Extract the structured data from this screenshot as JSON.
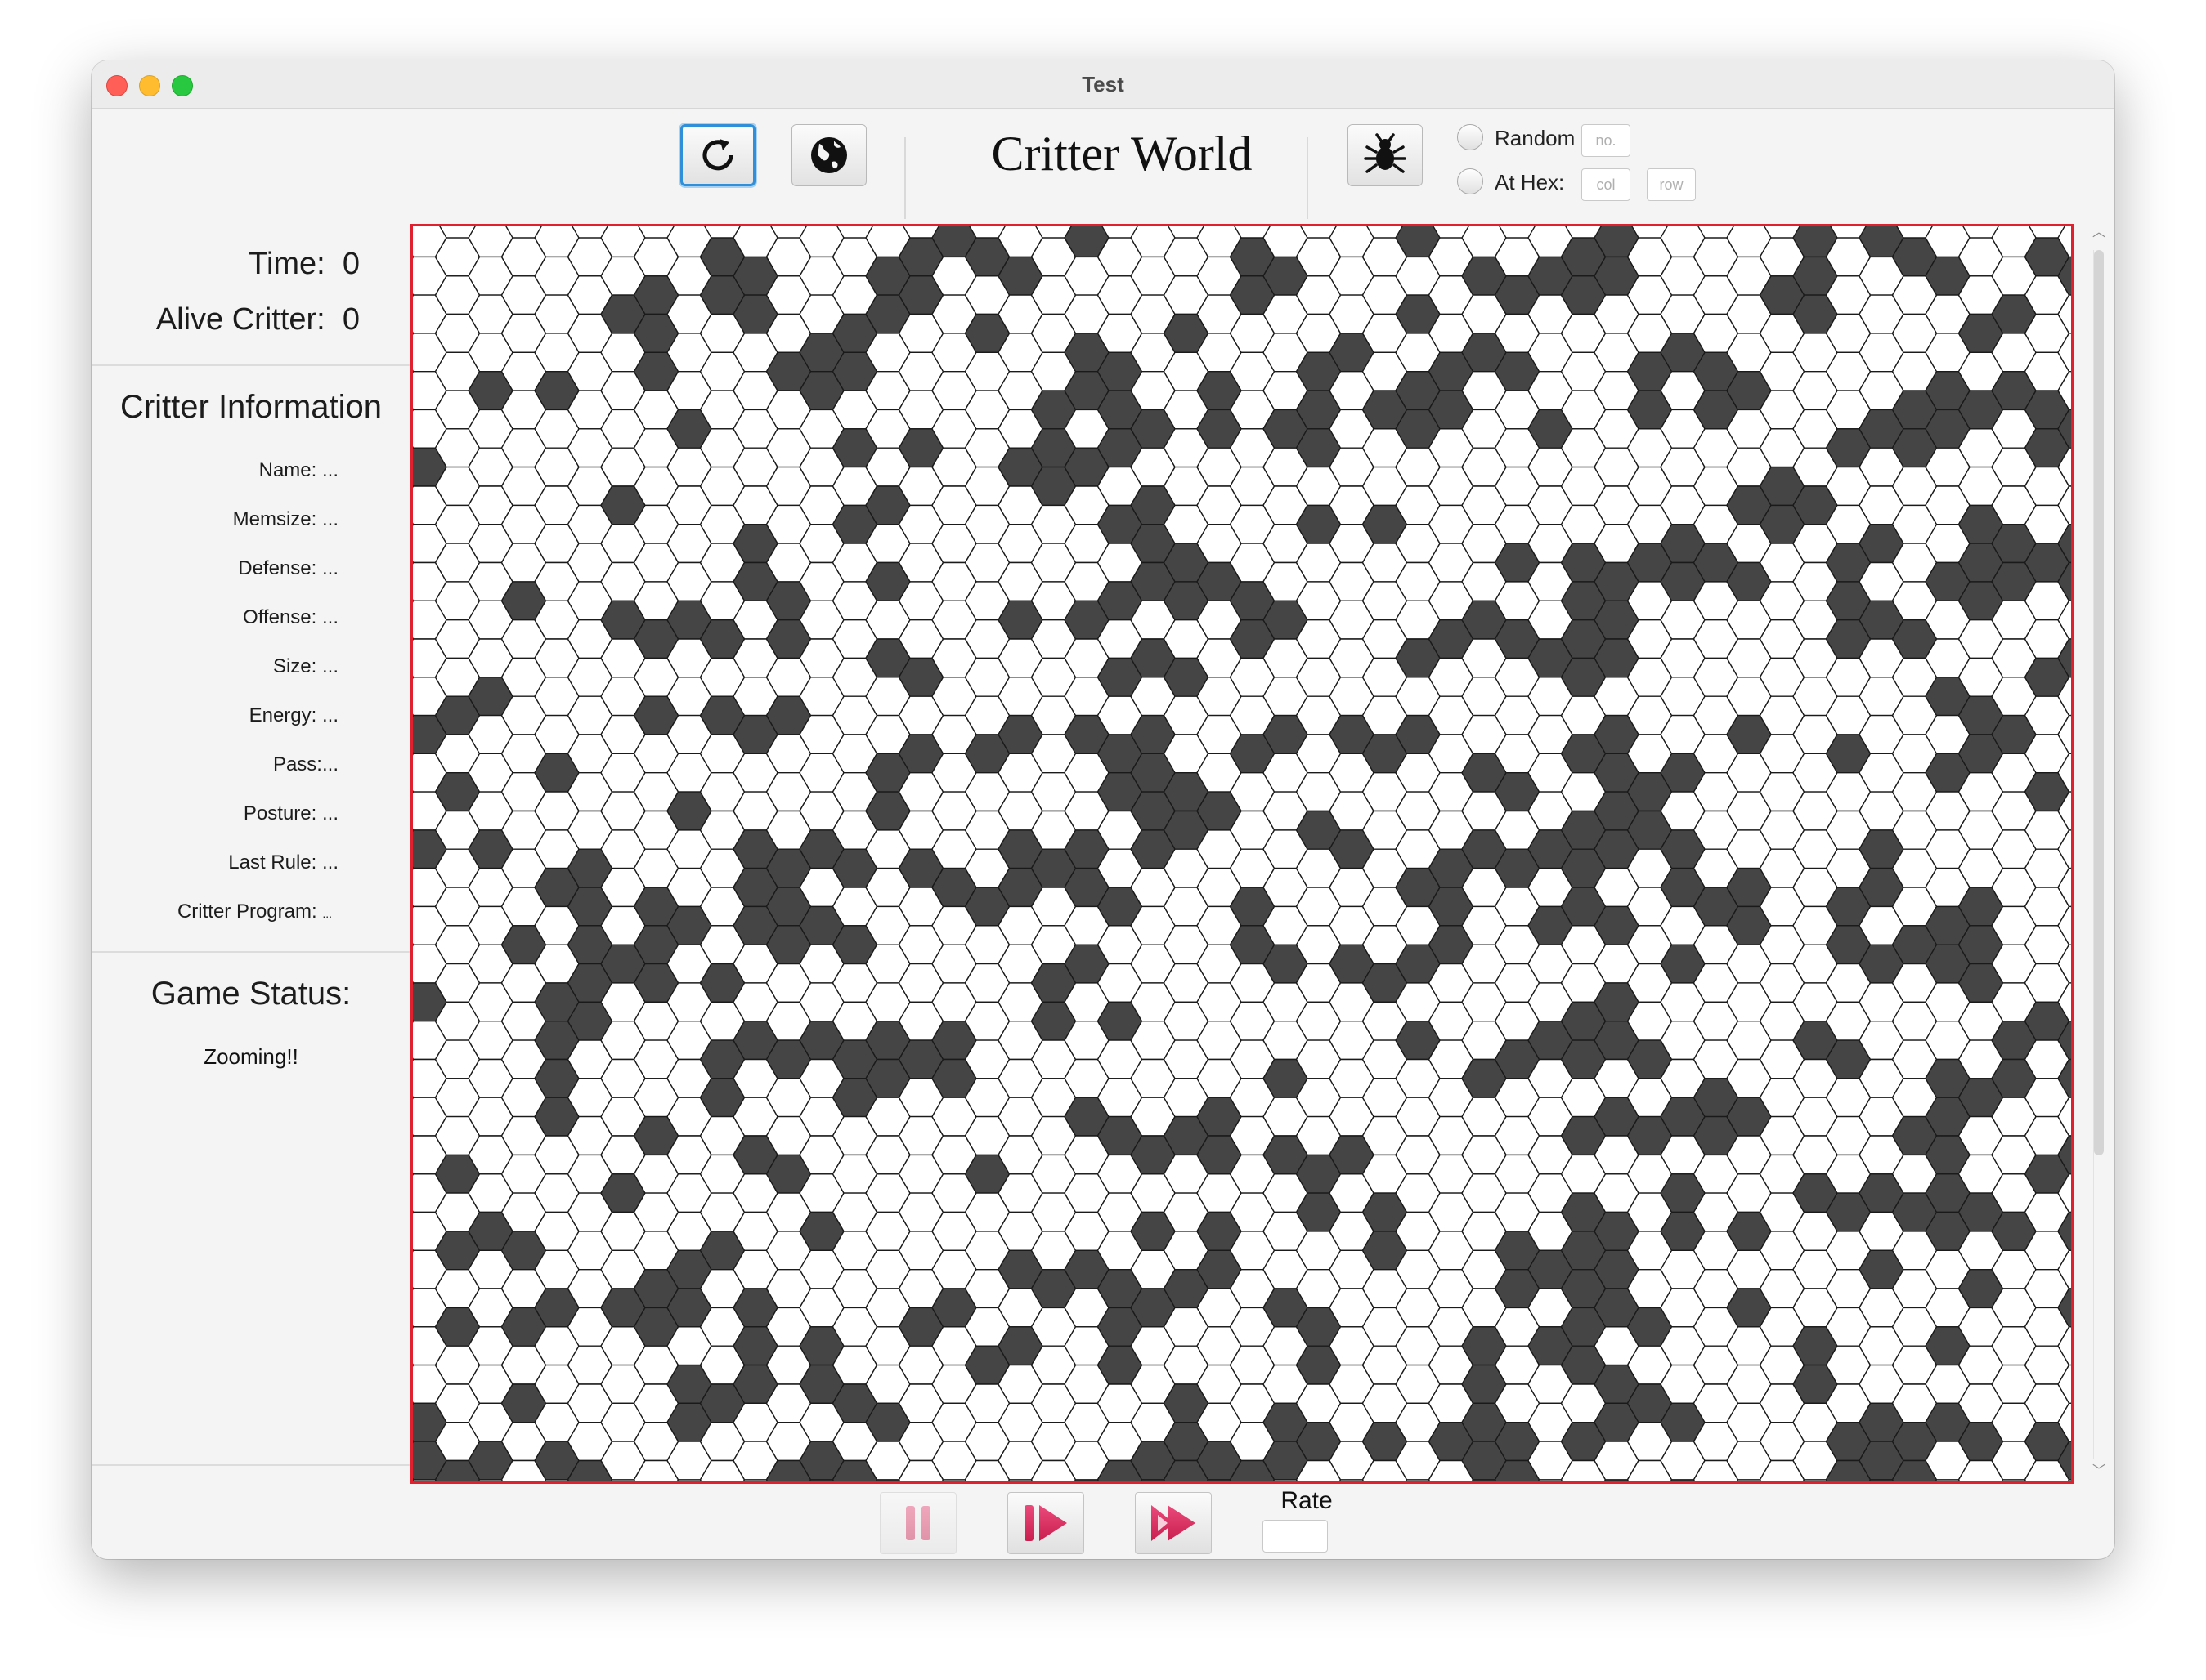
{
  "window": {
    "title": "Test"
  },
  "toolbar": {
    "app_title": "Critter World",
    "reset_icon": "refresh-icon",
    "world_icon": "globe-icon",
    "critter_icon": "critter-bug-icon",
    "placement": {
      "random_label": "Random",
      "at_hex_label": "At Hex:",
      "count_placeholder": "no.",
      "col_placeholder": "col",
      "row_placeholder": "row"
    }
  },
  "stats": {
    "time_label": "Time:",
    "time_value": "0",
    "alive_label": "Alive Critter:",
    "alive_value": "0"
  },
  "critter_info": {
    "heading": "Critter Information",
    "fields": [
      {
        "label": "Name:",
        "value": "..."
      },
      {
        "label": "Memsize:",
        "value": "..."
      },
      {
        "label": "Defense:",
        "value": "..."
      },
      {
        "label": "Offense:",
        "value": "..."
      },
      {
        "label": "Size:",
        "value": "..."
      },
      {
        "label": "Energy:",
        "value": "..."
      },
      {
        "label": "Pass:",
        "value": "..."
      },
      {
        "label": "Posture:",
        "value": "..."
      },
      {
        "label": "Last Rule:",
        "value": "..."
      },
      {
        "label": "Critter Program:",
        "value": "..."
      }
    ]
  },
  "game_status": {
    "heading": "Game Status:",
    "message": "Zooming!!"
  },
  "board": {
    "cell_colors": {
      "empty": "#ffffff",
      "rock": "#454545",
      "border": "#e0202f",
      "grid": "#1a1a1a"
    },
    "seed": 12345,
    "rock_fraction": 0.3
  },
  "controls": {
    "pause_icon": "pause-icon",
    "step_icon": "step-forward-icon",
    "run_icon": "fast-forward-icon",
    "rate_label": "Rate",
    "rate_value": "",
    "accent_color": "#d9285c"
  }
}
